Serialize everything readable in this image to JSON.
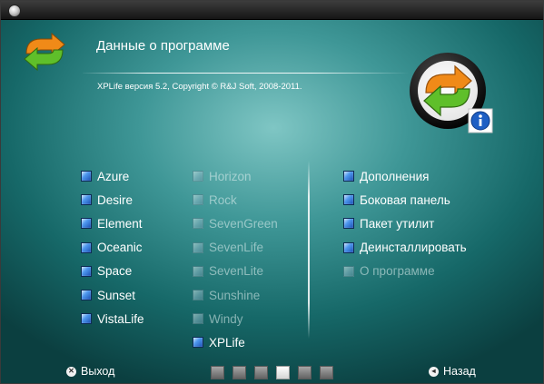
{
  "header": {
    "title": "Данные о программе",
    "version": "XPLife  версия 5.2,  Copyright © R&J Soft,  2008-2011."
  },
  "themes_left": [
    {
      "label": "Azure",
      "enabled": true
    },
    {
      "label": "Desire",
      "enabled": true
    },
    {
      "label": "Element",
      "enabled": true
    },
    {
      "label": "Oceanic",
      "enabled": true
    },
    {
      "label": "Space",
      "enabled": true
    },
    {
      "label": "Sunset",
      "enabled": true
    },
    {
      "label": "VistaLife",
      "enabled": true
    }
  ],
  "themes_right": [
    {
      "label": "Horizon",
      "enabled": false
    },
    {
      "label": "Rock",
      "enabled": false
    },
    {
      "label": "SevenGreen",
      "enabled": false
    },
    {
      "label": "SevenLife",
      "enabled": false
    },
    {
      "label": "SevenLite",
      "enabled": false
    },
    {
      "label": "Sunshine",
      "enabled": false
    },
    {
      "label": "Windy",
      "enabled": false
    },
    {
      "label": "XPLife",
      "enabled": true
    }
  ],
  "actions": [
    {
      "label": "Дополнения",
      "enabled": true
    },
    {
      "label": "Боковая панель",
      "enabled": true
    },
    {
      "label": "Пакет утилит",
      "enabled": true
    },
    {
      "label": "Деинсталлировать",
      "enabled": true
    },
    {
      "label": "О программе",
      "enabled": false
    }
  ],
  "footer": {
    "exit_label": "Выход",
    "back_label": "Назад",
    "exit_icon": "close-circle-icon",
    "back_icon": "back-circle-icon",
    "page_count": 6,
    "active_page": 4
  },
  "colors": {
    "bullet_blue": "#2f6fd6",
    "accent_orange": "#f08a18",
    "accent_green": "#5fbf2a",
    "info_blue": "#1e5fc4"
  }
}
